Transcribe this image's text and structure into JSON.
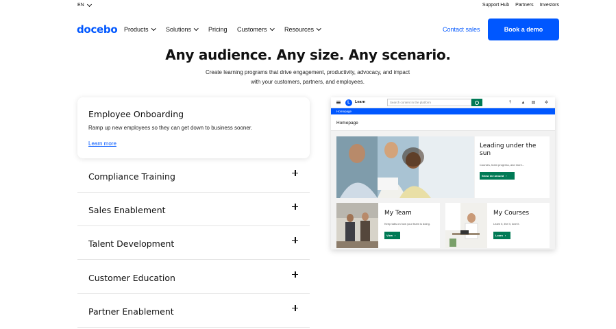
{
  "topbar": {
    "lang": "EN",
    "links": [
      "Support Hub",
      "Partners",
      "Investors"
    ]
  },
  "nav": {
    "logo": "docebo",
    "menu": [
      {
        "label": "Products",
        "dropdown": true
      },
      {
        "label": "Solutions",
        "dropdown": true
      },
      {
        "label": "Pricing",
        "dropdown": false
      },
      {
        "label": "Customers",
        "dropdown": true
      },
      {
        "label": "Resources",
        "dropdown": true
      }
    ],
    "contact": "Contact sales",
    "demo": "Book a demo"
  },
  "hero": {
    "title": "Any audience. Any size. Any scenario.",
    "subtitle": "Create learning programs that drive engagement, productivity, advocacy, and impact with your customers, partners, and employees."
  },
  "active_card": {
    "title": "Employee Onboarding",
    "description": "Ramp up new employees so they can get down to business sooner.",
    "link": "Learn more"
  },
  "accordion": [
    "Compliance Training",
    "Sales Enablement",
    "Talent Development",
    "Customer Education",
    "Partner Enablement"
  ],
  "app": {
    "name": "Learn",
    "logo_letter": "L",
    "search_placeholder": "Search content in the platform",
    "breadcrumb": "Homepage",
    "page_title": "Homepage",
    "lead": {
      "title": "Leading under the sun",
      "description": "Courses, team progress, and more...",
      "button": "Show me around"
    },
    "tiles": [
      {
        "title": "My Team",
        "description": "Keep tabs on how your team is doing.",
        "button": "View"
      },
      {
        "title": "My Courses",
        "description": "Learn it, live it, love it.",
        "button": "Learn"
      }
    ]
  },
  "colors": {
    "brand_blue": "#0057ff",
    "app_green": "#007a55"
  }
}
